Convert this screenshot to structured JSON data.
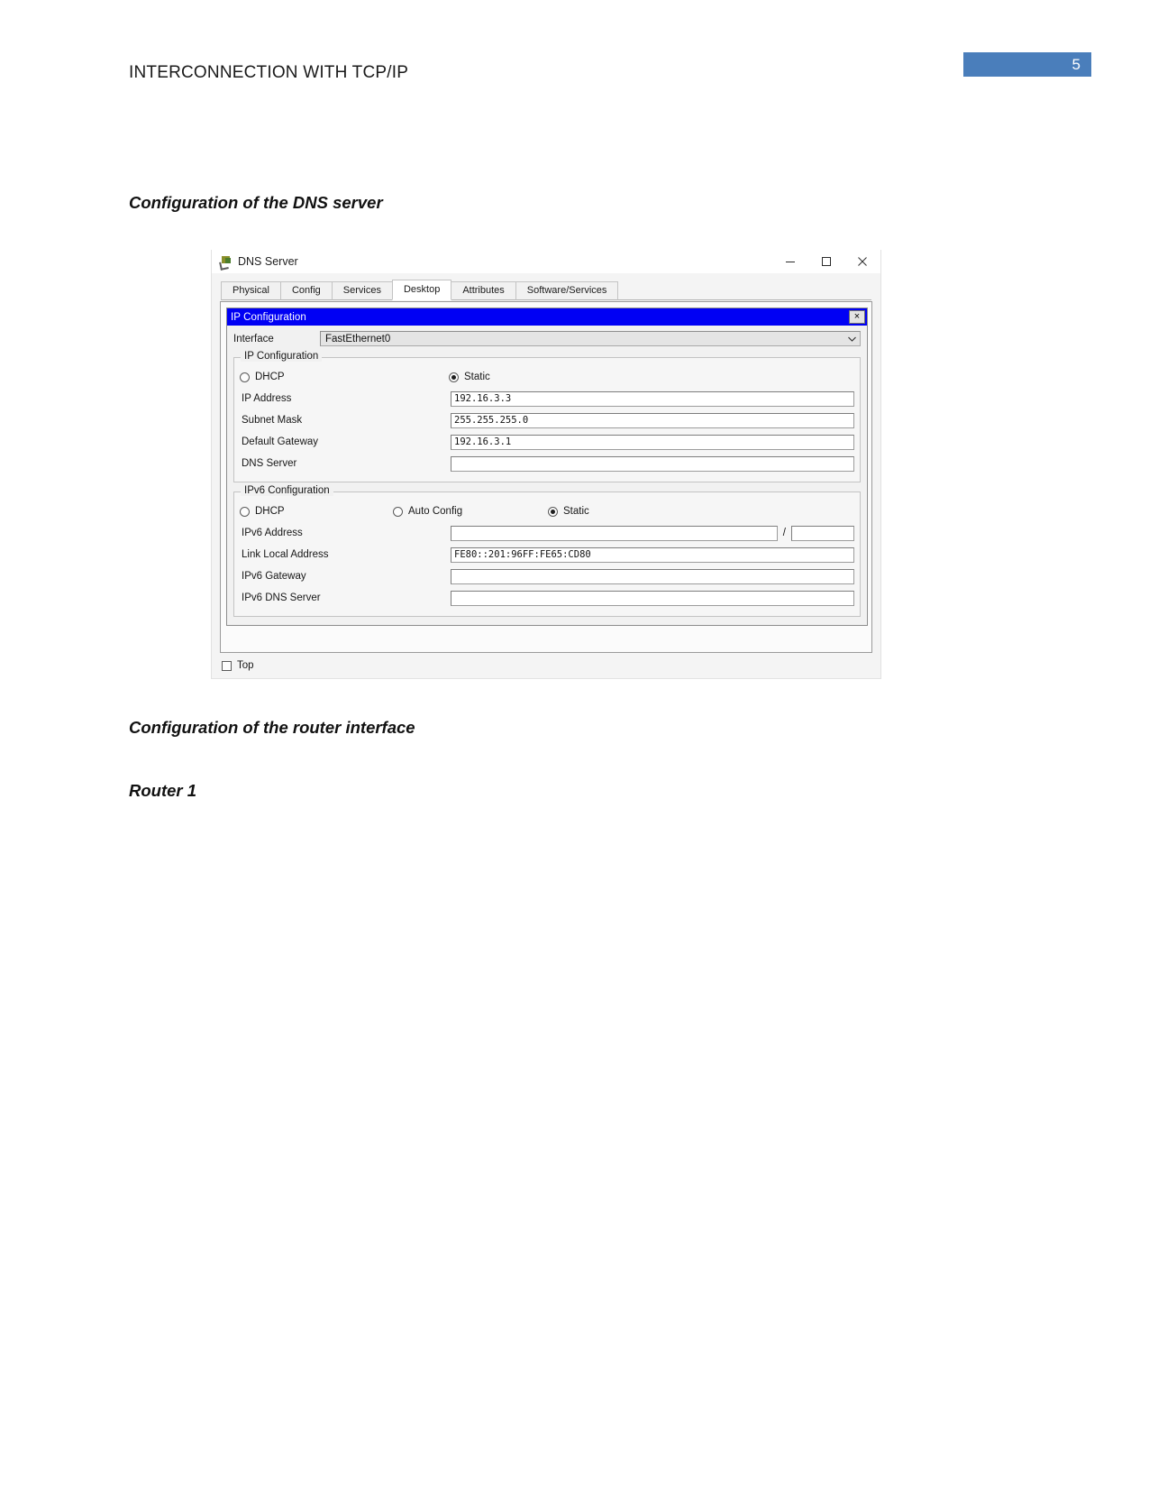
{
  "document": {
    "header_title": "INTERCONNECTION WITH TCP/IP",
    "page_number": "5",
    "page_badge_color": "#4a7ebb",
    "headings": {
      "dns": "Configuration of the DNS server",
      "router": "Configuration of the router interface",
      "router1": "Router 1"
    }
  },
  "window": {
    "title": "DNS Server",
    "icon": "packet-tracer-device-icon",
    "controls": {
      "minimize": "minimize-icon",
      "maximize": "maximize-icon",
      "close": "close-icon"
    },
    "tabs": [
      {
        "label": "Physical",
        "active": false
      },
      {
        "label": "Config",
        "active": false
      },
      {
        "label": "Services",
        "active": false
      },
      {
        "label": "Desktop",
        "active": true
      },
      {
        "label": "Attributes",
        "active": false
      },
      {
        "label": "Software/Services",
        "active": false
      }
    ],
    "footer_checkbox": {
      "label": "Top",
      "checked": false
    }
  },
  "ip_configuration": {
    "panel_title": "IP Configuration",
    "panel_title_color": "#0000f4",
    "close_button": "×",
    "interface": {
      "label": "Interface",
      "value": "FastEthernet0"
    },
    "ipv4": {
      "group_title": "IP Configuration",
      "modes": [
        {
          "label": "DHCP",
          "selected": false
        },
        {
          "label": "Static",
          "selected": true
        }
      ],
      "fields": [
        {
          "label": "IP Address",
          "value": "192.16.3.3"
        },
        {
          "label": "Subnet Mask",
          "value": "255.255.255.0"
        },
        {
          "label": "Default Gateway",
          "value": "192.16.3.1"
        },
        {
          "label": "DNS Server",
          "value": ""
        }
      ]
    },
    "ipv6": {
      "group_title": "IPv6 Configuration",
      "modes": [
        {
          "label": "DHCP",
          "selected": false
        },
        {
          "label": "Auto Config",
          "selected": false
        },
        {
          "label": "Static",
          "selected": true
        }
      ],
      "address": {
        "label": "IPv6 Address",
        "value": "",
        "separator": "/",
        "prefix": ""
      },
      "fields": [
        {
          "label": "Link Local Address",
          "value": "FE80::201:96FF:FE65:CD80"
        },
        {
          "label": "IPv6 Gateway",
          "value": ""
        },
        {
          "label": "IPv6 DNS Server",
          "value": ""
        }
      ]
    }
  }
}
